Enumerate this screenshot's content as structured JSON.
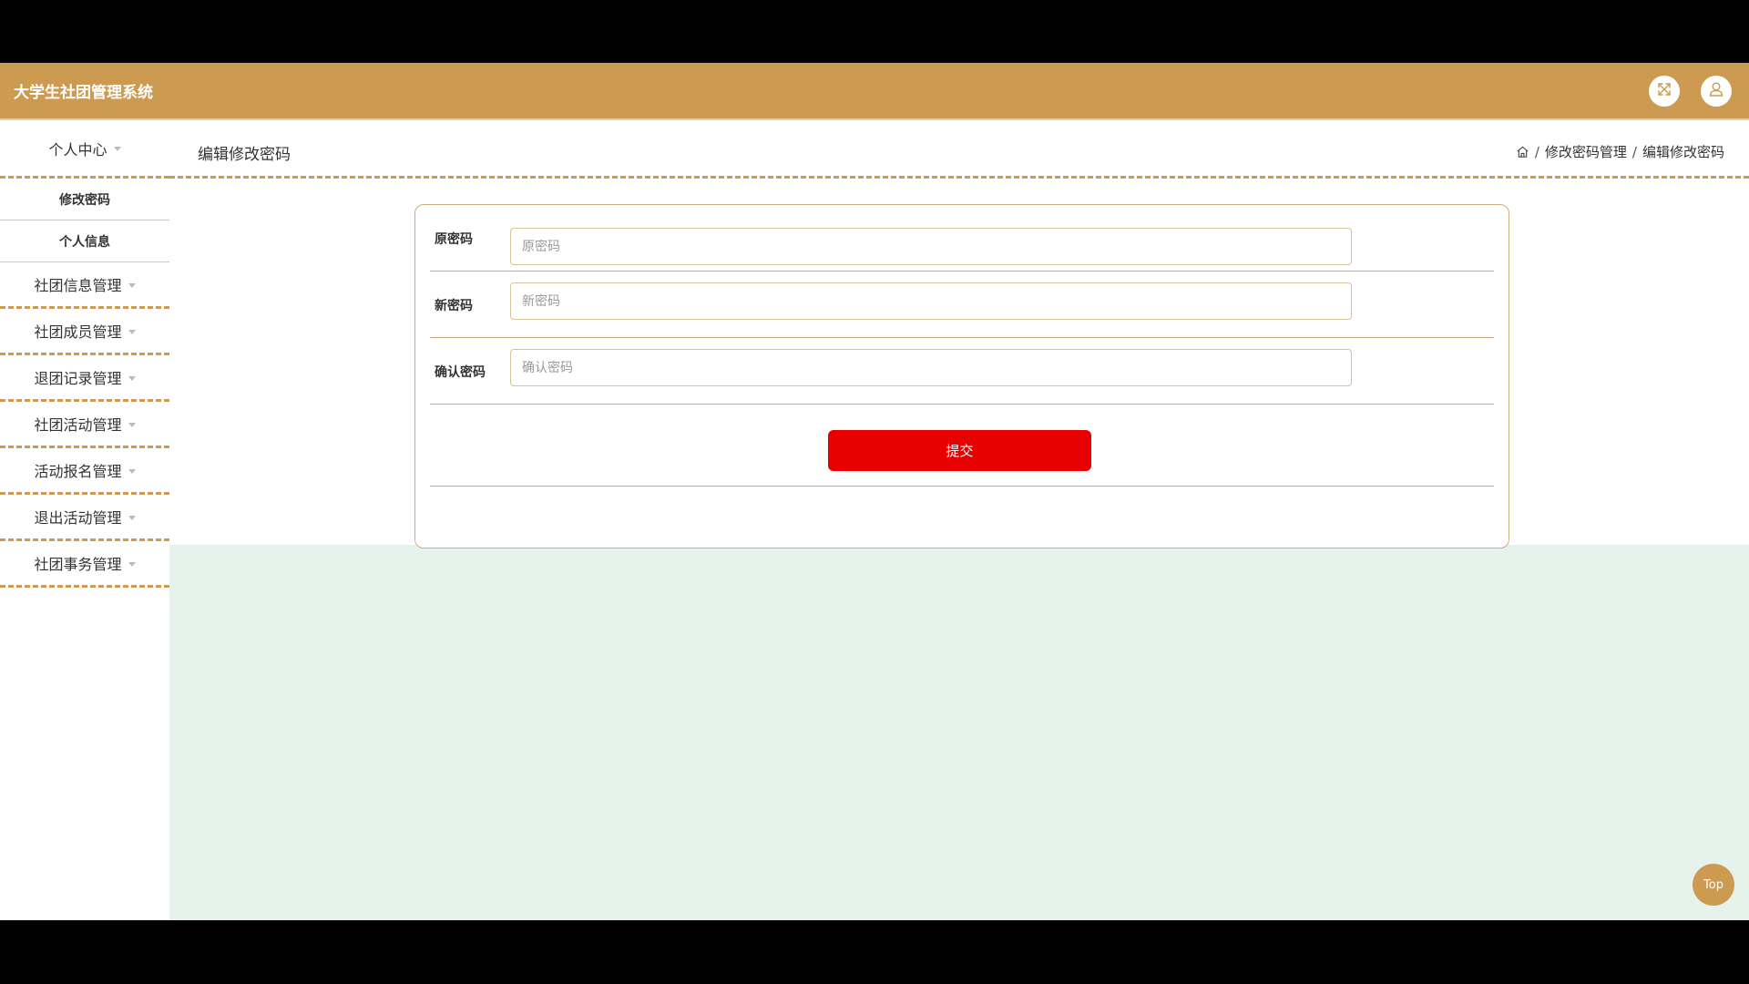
{
  "header": {
    "title": "大学生社团管理系统",
    "fullscreen_icon": "fullscreen-icon",
    "user_icon": "user-icon",
    "accent_color": "#CC9A50"
  },
  "sidebar": {
    "sections": [
      {
        "label": "个人中心",
        "expanded": true,
        "items": [
          {
            "label": "修改密码"
          },
          {
            "label": "个人信息"
          }
        ]
      },
      {
        "label": "社团信息管理"
      },
      {
        "label": "社团成员管理"
      },
      {
        "label": "退团记录管理"
      },
      {
        "label": "社团活动管理"
      },
      {
        "label": "活动报名管理"
      },
      {
        "label": "退出活动管理"
      },
      {
        "label": "社团事务管理"
      }
    ]
  },
  "page": {
    "title": "编辑修改密码",
    "breadcrumb": {
      "home_icon": "home-icon",
      "items": [
        "修改密码管理",
        "编辑修改密码"
      ],
      "separator": "/"
    }
  },
  "form": {
    "fields": [
      {
        "label": "原密码",
        "placeholder": "原密码",
        "value": ""
      },
      {
        "label": "新密码",
        "placeholder": "新密码",
        "value": ""
      },
      {
        "label": "确认密码",
        "placeholder": "确认密码",
        "value": ""
      }
    ],
    "submit_label": "提交",
    "submit_color": "#E80000"
  },
  "back_to_top": {
    "label": "Top"
  }
}
